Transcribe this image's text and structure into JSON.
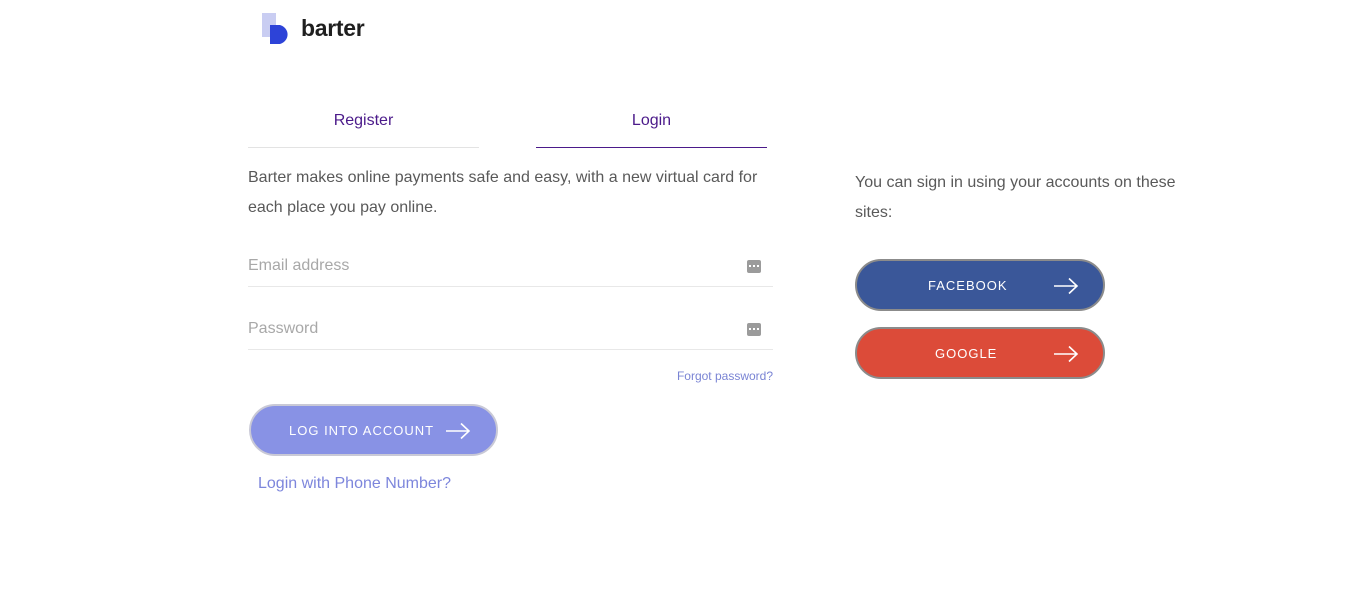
{
  "brand": {
    "name": "barter",
    "colors": {
      "logo_light": "#c9cdf2",
      "logo_dark": "#2d43d8",
      "primary": "#4b1a8a"
    }
  },
  "tabs": [
    {
      "label": "Register",
      "active": false
    },
    {
      "label": "Login",
      "active": true
    }
  ],
  "intro": "Barter makes online payments safe and easy, with a new virtual card for each place you pay online.",
  "form": {
    "email": {
      "placeholder": "Email address",
      "value": "",
      "icon": "autofill-icon"
    },
    "password": {
      "placeholder": "Password",
      "value": "",
      "icon": "autofill-icon"
    },
    "forgot_label": "Forgot password?",
    "submit_label": "LOG INTO ACCOUNT",
    "submit_icon": "arrow-right-icon",
    "phone_link": "Login with Phone Number?"
  },
  "social": {
    "intro": "You can sign in using your accounts on these sites:",
    "buttons": [
      {
        "label": "FACEBOOK",
        "color": "#3a5799",
        "icon": "arrow-right-icon"
      },
      {
        "label": "GOOGLE",
        "color": "#dc4b39",
        "icon": "arrow-right-icon"
      }
    ]
  }
}
